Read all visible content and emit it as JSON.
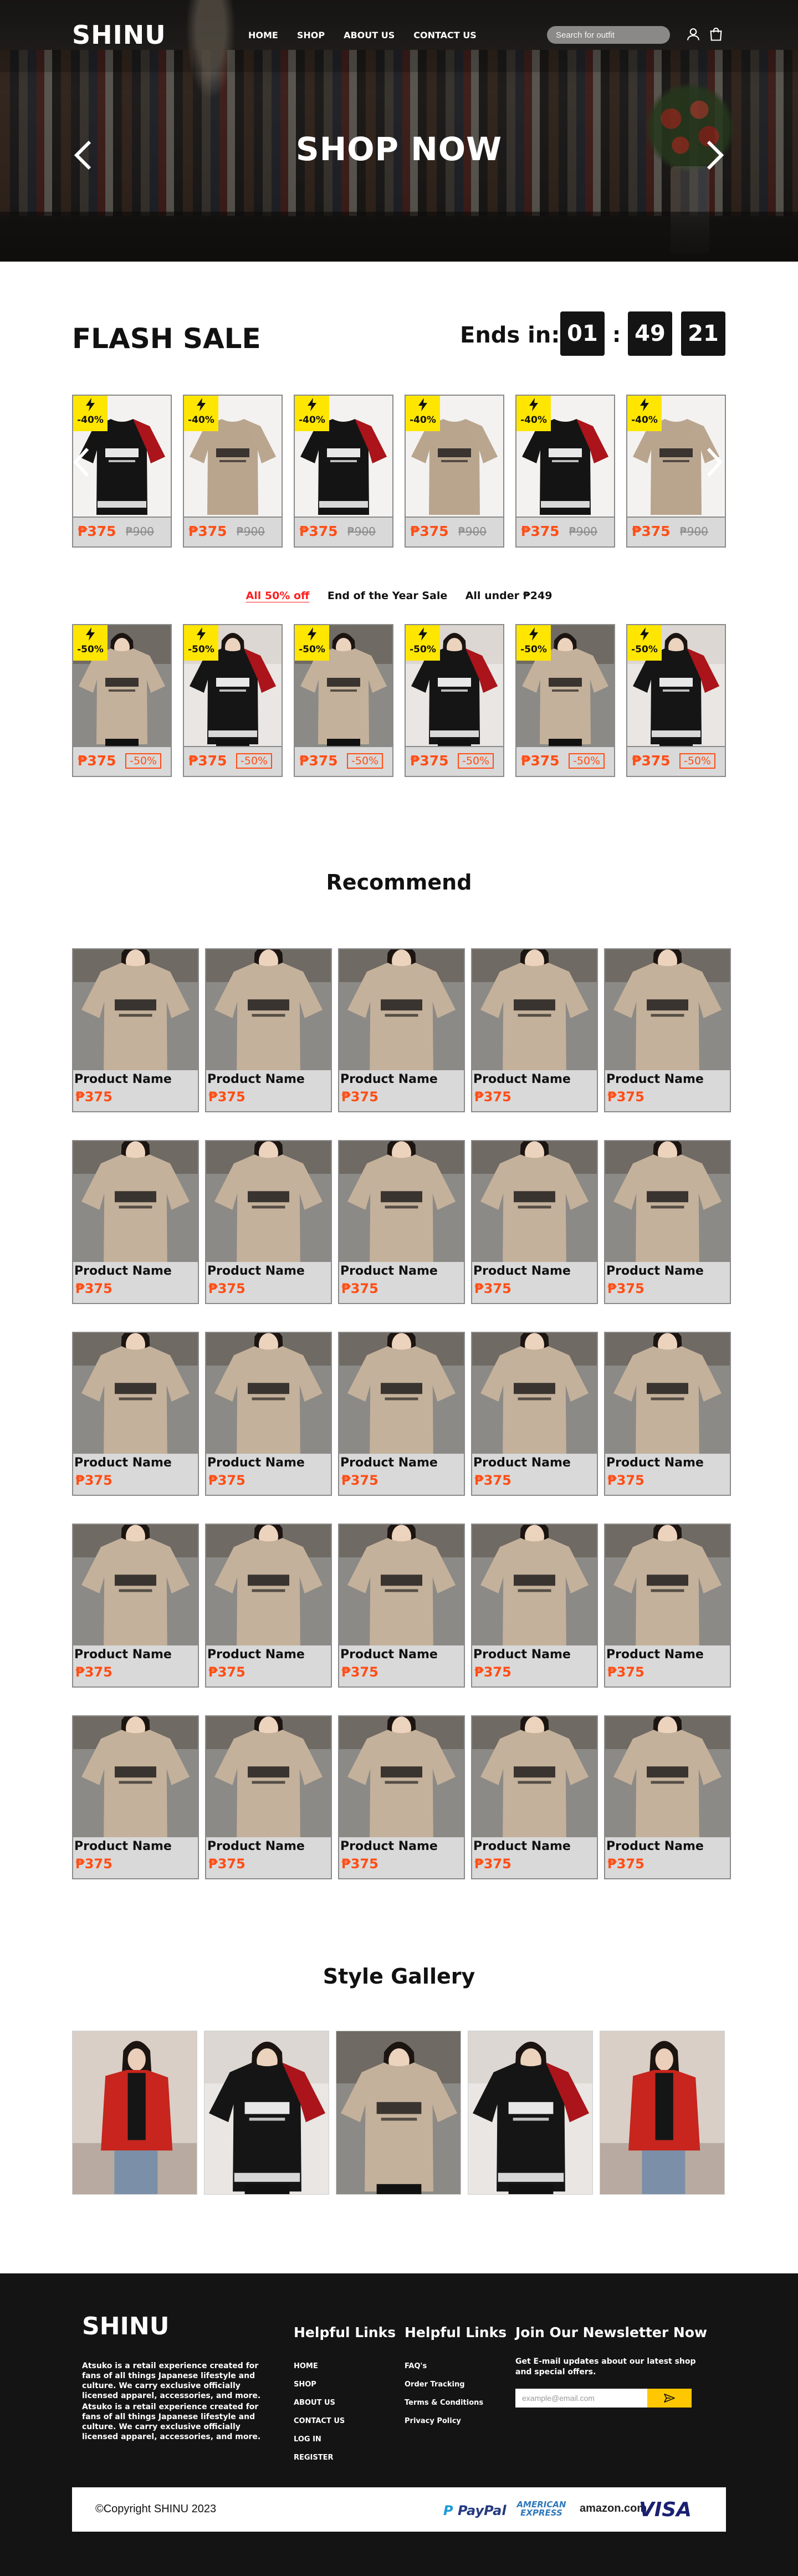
{
  "header": {
    "logo": "SHINU",
    "nav": [
      "HOME",
      "SHOP",
      "ABOUT US",
      "CONTACT US"
    ],
    "search_placeholder": "Search for outfit",
    "icons": [
      "user-icon",
      "shopping-bag-icon"
    ]
  },
  "hero": {
    "title": "SHOP NOW",
    "icons": [
      "chevron-left-icon",
      "chevron-right-icon"
    ]
  },
  "flash_sale": {
    "title": "FLASH SALE",
    "ends_label": "Ends in:",
    "timer": {
      "hours": "01",
      "minutes": "49",
      "seconds": "21"
    },
    "products": [
      {
        "badge": "-40%",
        "price": "₱375",
        "old_price": "₱900",
        "style": "black-red"
      },
      {
        "badge": "-40%",
        "price": "₱375",
        "old_price": "₱900",
        "style": "beige"
      },
      {
        "badge": "-40%",
        "price": "₱375",
        "old_price": "₱900",
        "style": "black-red"
      },
      {
        "badge": "-40%",
        "price": "₱375",
        "old_price": "₱900",
        "style": "beige"
      },
      {
        "badge": "-40%",
        "price": "₱375",
        "old_price": "₱900",
        "style": "black-red"
      },
      {
        "badge": "-40%",
        "price": "₱375",
        "old_price": "₱900",
        "style": "beige"
      }
    ]
  },
  "promo_tabs": [
    "All 50% off",
    "End of the Year Sale",
    "All under ₱249"
  ],
  "promo_products": [
    {
      "badge": "-50%",
      "price": "₱375",
      "discount": "-50%",
      "style": "beige-model"
    },
    {
      "badge": "-50%",
      "price": "₱375",
      "discount": "-50%",
      "style": "black-model"
    },
    {
      "badge": "-50%",
      "price": "₱375",
      "discount": "-50%",
      "style": "beige-model"
    },
    {
      "badge": "-50%",
      "price": "₱375",
      "discount": "-50%",
      "style": "black-model"
    },
    {
      "badge": "-50%",
      "price": "₱375",
      "discount": "-50%",
      "style": "beige-model"
    },
    {
      "badge": "-50%",
      "price": "₱375",
      "discount": "-50%",
      "style": "black-model"
    }
  ],
  "recommend": {
    "title": "Recommend",
    "rows": [
      [
        {
          "name": "Product Name",
          "price": "₱375"
        },
        {
          "name": "Product Name",
          "price": "₱375"
        },
        {
          "name": "Product Name",
          "price": "₱375"
        },
        {
          "name": "Product Name",
          "price": "₱375"
        },
        {
          "name": "Product Name",
          "price": "₱375"
        }
      ],
      [
        {
          "name": "Product Name",
          "price": "₱375"
        },
        {
          "name": "Product Name",
          "price": "₱375"
        },
        {
          "name": "Product Name",
          "price": "₱375"
        },
        {
          "name": "Product Name",
          "price": "₱375"
        },
        {
          "name": "Product Name",
          "price": "₱375"
        }
      ],
      [
        {
          "name": "Product Name",
          "price": "₱375"
        },
        {
          "name": "Product Name",
          "price": "₱375"
        },
        {
          "name": "Product Name",
          "price": "₱375"
        },
        {
          "name": "Product Name",
          "price": "₱375"
        },
        {
          "name": "Product Name",
          "price": "₱375"
        }
      ],
      [
        {
          "name": "Product Name",
          "price": "₱375"
        },
        {
          "name": "Product Name",
          "price": "₱375"
        },
        {
          "name": "Product Name",
          "price": "₱375"
        },
        {
          "name": "Product Name",
          "price": "₱375"
        },
        {
          "name": "Product Name",
          "price": "₱375"
        }
      ],
      [
        {
          "name": "Product Name",
          "price": "₱375"
        },
        {
          "name": "Product Name",
          "price": "₱375"
        },
        {
          "name": "Product Name",
          "price": "₱375"
        },
        {
          "name": "Product Name",
          "price": "₱375"
        },
        {
          "name": "Product Name",
          "price": "₱375"
        }
      ]
    ]
  },
  "gallery": {
    "title": "Style Gallery",
    "images": [
      "red-jacket",
      "black-red-shirt",
      "beige-shirt",
      "black-red-shirt-2",
      "red-jacket-2"
    ]
  },
  "footer": {
    "logo": "SHINU",
    "about": [
      "Atsuko is a retail experience created for fans of all things Japanese lifestyle and culture. We carry exclusive officially licensed apparel, accessories, and more.",
      "Atsuko is a retail experience created for fans of all things Japanese lifestyle and culture. We carry exclusive officially licensed apparel, accessories, and more."
    ],
    "helpful_links_1": {
      "title": "Helpful Links",
      "items": [
        "HOME",
        "SHOP",
        "ABOUT US",
        "CONTACT US",
        "LOG IN",
        "REGISTER"
      ]
    },
    "helpful_links_2": {
      "title": "Helpful Links",
      "items": [
        "FAQ's",
        "Order Tracking",
        "Terms & Conditions",
        "Privacy Policy"
      ]
    },
    "newsletter": {
      "title": "Join Our Newsletter Now",
      "text": "Get E-mail updates about our latest shop and special offers.",
      "placeholder": "example@email.com"
    },
    "copyright": "©Copyright SHINU 2023",
    "payments": [
      "PayPal",
      "AMERICAN EXPRESS",
      "amazon.com",
      "VISA"
    ],
    "colors": {
      "accent": "#ff4d15",
      "badge": "#ffe600",
      "send": "#ffc700",
      "footer_bg": "#141414"
    }
  }
}
